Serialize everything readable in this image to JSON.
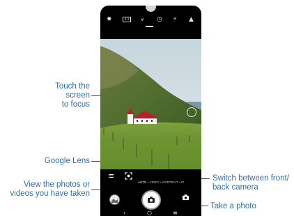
{
  "annotations": {
    "touch_focus": "Touch the screen\nto focus",
    "google_lens": "Google Lens",
    "view_photos": "View the photos or\nvideos you have taken",
    "switch_camera": "Switch between front/\nback camera",
    "take_photo": "Take a photo"
  },
  "camera": {
    "top_icons": [
      "settings-icon",
      "aspect-ratio-icon",
      "portrait-icon",
      "timer-icon",
      "flash-off-icon",
      "filter-icon"
    ],
    "modes": [
      "AUTO",
      "VIDEO",
      "PORTRAIT",
      "PI"
    ],
    "active_mode": "AUTO"
  },
  "navbar": {
    "back": "‹",
    "home": "○",
    "recents": "≡"
  },
  "colors": {
    "annotation_text": "#2f6fa8",
    "leader_line": "#444444"
  }
}
